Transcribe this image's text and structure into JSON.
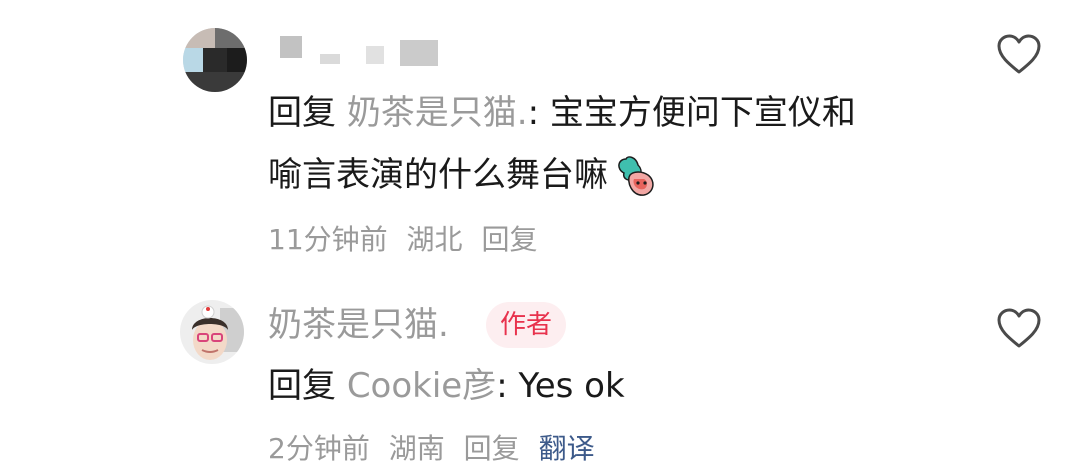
{
  "comments": [
    {
      "reply_prefix": "回复",
      "reply_target": "奶茶是只猫.",
      "text_line1": ": 宝宝方便问下宣仪和",
      "text_line2": "喻言表演的什么舞台嘛",
      "emoji": "cute-sticker-emoji",
      "time": "11分钟前",
      "location": "湖北",
      "reply_label": "回复",
      "like_icon": "heart-outline-icon"
    },
    {
      "author_name": "奶茶是只猫.",
      "author_badge": "作者",
      "reply_prefix": "回复",
      "reply_target": "Cookie彦",
      "text": ": Yes ok",
      "time": "2分钟前",
      "location": "湖南",
      "reply_label": "回复",
      "translate_label": "翻译",
      "like_icon": "heart-outline-icon"
    }
  ],
  "colors": {
    "primary_text": "#1a1a1a",
    "secondary_text": "#9a9a9a",
    "badge_text": "#e8324d",
    "badge_bg": "#fdeef0",
    "translate": "#3d5a8a"
  }
}
